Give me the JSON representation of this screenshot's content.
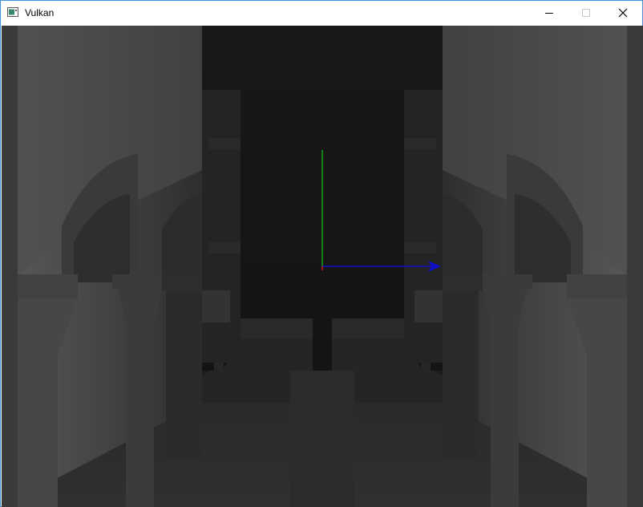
{
  "window": {
    "title": "Vulkan",
    "icon": "app-window-icon",
    "controls": [
      "minimize-icon",
      "maximize-icon",
      "close-icon"
    ],
    "accent_border": "#3c8fd8"
  },
  "viewport": {
    "render_mode": "depth",
    "axis_gizmo": {
      "x_color": "#1010c8",
      "y_color": "#18e818",
      "z_color": "#d01818"
    }
  }
}
